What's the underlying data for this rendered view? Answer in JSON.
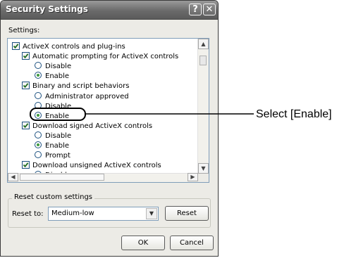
{
  "window": {
    "title": "Security Settings",
    "help_glyph": "?",
    "close_glyph": "✕"
  },
  "settings_label": "Settings:",
  "tree": [
    {
      "kind": "checkbox",
      "level": 0,
      "label": "ActiveX controls and plug-ins"
    },
    {
      "kind": "checkbox",
      "level": 1,
      "label": "Automatic prompting for ActiveX controls"
    },
    {
      "kind": "radio",
      "level": 2,
      "label": "Disable",
      "checked": false
    },
    {
      "kind": "radio",
      "level": 2,
      "label": "Enable",
      "checked": true
    },
    {
      "kind": "checkbox",
      "level": 1,
      "label": "Binary and script behaviors"
    },
    {
      "kind": "radio",
      "level": 2,
      "label": "Administrator approved",
      "checked": false
    },
    {
      "kind": "radio",
      "level": 2,
      "label": "Disable",
      "checked": false
    },
    {
      "kind": "radio",
      "level": 2,
      "label": "Enable",
      "checked": true
    },
    {
      "kind": "checkbox",
      "level": 1,
      "label": "Download signed ActiveX controls"
    },
    {
      "kind": "radio",
      "level": 2,
      "label": "Disable",
      "checked": false
    },
    {
      "kind": "radio",
      "level": 2,
      "label": "Enable",
      "checked": true
    },
    {
      "kind": "radio",
      "level": 2,
      "label": "Prompt",
      "checked": false
    },
    {
      "kind": "checkbox",
      "level": 1,
      "label": "Download unsigned ActiveX controls"
    },
    {
      "kind": "radio",
      "level": 2,
      "label": "Disable",
      "checked": true
    }
  ],
  "reset_group": {
    "legend": "Reset custom settings",
    "reset_to_label": "Reset to:",
    "selected_level": "Medium-low",
    "reset_button": "Reset"
  },
  "buttons": {
    "ok": "OK",
    "cancel": "Cancel"
  },
  "callout": {
    "text": "Select [Enable]"
  }
}
